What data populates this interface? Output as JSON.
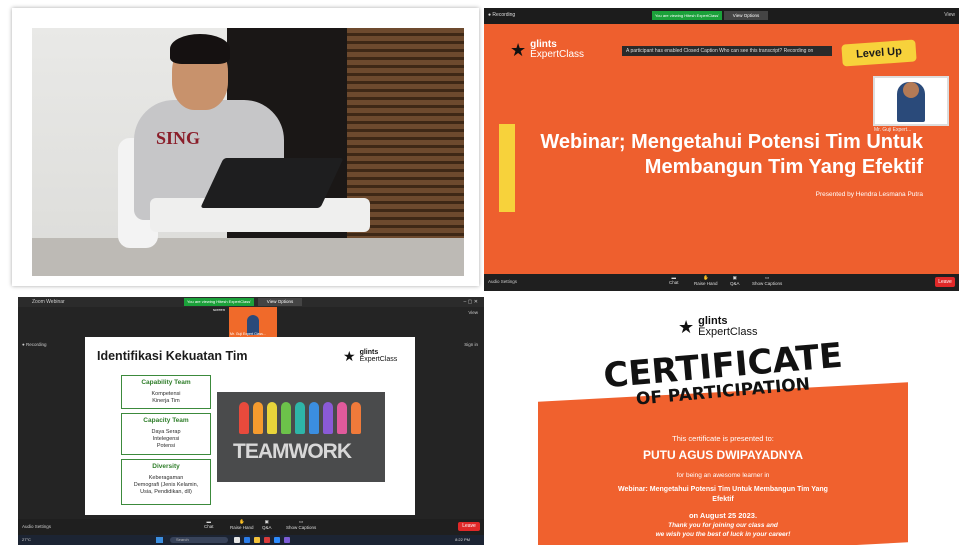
{
  "webinar": {
    "banner": "You are viewing Hitesh ExpertClass' screen",
    "view_options": "View Options",
    "recording": "Recording",
    "toast": "A participant has enabled Closed Caption  Who can see this transcript?  Recording on",
    "level_up": "Level Up",
    "brand_line1": "glints",
    "brand_line2": "ExpertClass",
    "title_line1": "Webinar; Mengetahui Potensi Tim Untuk",
    "title_line2": "Membangun Tim Yang Efektif",
    "presented_by": "Presented by Hendra Lesmana Putra",
    "pip_name": "Mr. Guji Expert...",
    "gallery": "View",
    "audio_settings": "Audio Settings",
    "controls": [
      "Chat",
      "Raise Hand",
      "Q&A",
      "Show Captions"
    ],
    "leave": "Leave"
  },
  "zoom_slide": {
    "window_title": "Zoom Webinar",
    "banner": "You are viewing Hitesh ExpertClass' screen",
    "view_options": "View Options",
    "recording": "Recording",
    "pip_name": "Mr. Guji Expert Class...",
    "view": "View",
    "sign_in": "Sign in",
    "slide_title": "Identifikasi Kekuatan Tim",
    "brand_line1": "glints",
    "brand_line2": "ExpertClass",
    "boxes": [
      {
        "header": "Capability Team",
        "lines": [
          "Kompetensi",
          "Kinerja Tim"
        ]
      },
      {
        "header": "Capacity Team",
        "lines": [
          "Daya Serap",
          "Intelegensi",
          "Potensi"
        ]
      },
      {
        "header": "Diversity",
        "lines": [
          "Keberagaman",
          "Demografi (Jenis Kelamin,",
          "Usia, Pendidikan, dll)"
        ]
      }
    ],
    "teamwork": "TEAMWORK",
    "audio_settings": "Audio Settings",
    "controls": [
      "Chat",
      "Raise Hand",
      "Q&A",
      "Show Captions"
    ],
    "leave": "Leave",
    "taskbar_weather": "27°C",
    "taskbar_search": "Search",
    "clock": "8:22 PM"
  },
  "certificate": {
    "brand_line1": "glints",
    "brand_line2": "ExpertClass",
    "title1": "CERTIFICATE",
    "title2": "OF PARTICIPATION",
    "presented": "This certificate is presented to:",
    "name": "PUTU AGUS DWIPAYADNYA",
    "for_being": "for being an awesome learner in",
    "course_line1": "Webinar: Mengetahui Potensi Tim Untuk Membangun Tim Yang",
    "course_line2": "Efektif",
    "date": "on August 25 2023.",
    "thanks1": "Thank you for joining our class and",
    "thanks2": "we wish you the best of luck in your career!"
  },
  "photo": {
    "shirt_text": "SING"
  }
}
